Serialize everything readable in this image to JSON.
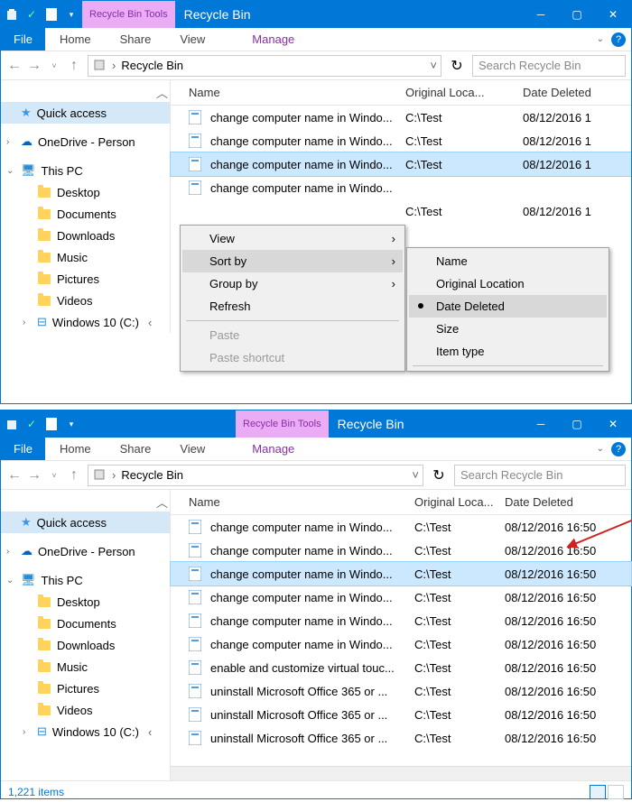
{
  "window1": {
    "tool_tab": "Recycle Bin Tools",
    "title": "Recycle Bin",
    "tabs": {
      "file": "File",
      "home": "Home",
      "share": "Share",
      "view": "View",
      "manage": "Manage"
    },
    "breadcrumb": "Recycle Bin",
    "search_placeholder": "Search Recycle Bin",
    "sidebar": {
      "quick": "Quick access",
      "onedrive": "OneDrive - Person",
      "thispc": "This PC",
      "desktop": "Desktop",
      "documents": "Documents",
      "downloads": "Downloads",
      "music": "Music",
      "pictures": "Pictures",
      "videos": "Videos",
      "cdrive": "Windows 10 (C:)"
    },
    "headers": {
      "name": "Name",
      "loc": "Original Loca...",
      "date": "Date Deleted"
    },
    "rows": [
      {
        "name": "change computer name in Windo...",
        "loc": "C:\\Test",
        "date": "08/12/2016 1"
      },
      {
        "name": "change computer name in Windo...",
        "loc": "C:\\Test",
        "date": "08/12/2016 1"
      },
      {
        "name": "change computer name in Windo...",
        "loc": "C:\\Test",
        "date": "08/12/2016 1"
      },
      {
        "name": "change computer name in Windo...",
        "loc": "",
        "date": ""
      },
      {
        "name": "",
        "loc": "C:\\Test",
        "date": "08/12/2016 1"
      }
    ],
    "ctx": {
      "view": "View",
      "sort": "Sort by",
      "group": "Group by",
      "refresh": "Refresh",
      "paste": "Paste",
      "paste_shortcut": "Paste shortcut"
    },
    "submenu": {
      "name": "Name",
      "loc": "Original Location",
      "date": "Date Deleted",
      "size": "Size",
      "itemtype": "Item type"
    }
  },
  "window2": {
    "tool_tab": "Recycle Bin Tools",
    "title": "Recycle Bin",
    "tabs": {
      "file": "File",
      "home": "Home",
      "share": "Share",
      "view": "View",
      "manage": "Manage"
    },
    "breadcrumb": "Recycle Bin",
    "search_placeholder": "Search Recycle Bin",
    "sidebar": {
      "quick": "Quick access",
      "onedrive": "OneDrive - Person",
      "thispc": "This PC",
      "desktop": "Desktop",
      "documents": "Documents",
      "downloads": "Downloads",
      "music": "Music",
      "pictures": "Pictures",
      "videos": "Videos",
      "cdrive": "Windows 10 (C:)"
    },
    "headers": {
      "name": "Name",
      "loc": "Original Loca...",
      "date": "Date Deleted"
    },
    "rows": [
      {
        "name": "change computer name in Windo...",
        "loc": "C:\\Test",
        "date": "08/12/2016 16:50"
      },
      {
        "name": "change computer name in Windo...",
        "loc": "C:\\Test",
        "date": "08/12/2016 16:50"
      },
      {
        "name": "change computer name in Windo...",
        "loc": "C:\\Test",
        "date": "08/12/2016 16:50"
      },
      {
        "name": "change computer name in Windo...",
        "loc": "C:\\Test",
        "date": "08/12/2016 16:50"
      },
      {
        "name": "change computer name in Windo...",
        "loc": "C:\\Test",
        "date": "08/12/2016 16:50"
      },
      {
        "name": "change computer name in Windo...",
        "loc": "C:\\Test",
        "date": "08/12/2016 16:50"
      },
      {
        "name": "enable and customize virtual touc...",
        "loc": "C:\\Test",
        "date": "08/12/2016 16:50"
      },
      {
        "name": "uninstall Microsoft Office 365 or ...",
        "loc": "C:\\Test",
        "date": "08/12/2016 16:50"
      },
      {
        "name": "uninstall Microsoft Office 365 or ...",
        "loc": "C:\\Test",
        "date": "08/12/2016 16:50"
      },
      {
        "name": "uninstall Microsoft Office 365 or ...",
        "loc": "C:\\Test",
        "date": "08/12/2016 16:50"
      }
    ],
    "status": "1,221 items"
  }
}
